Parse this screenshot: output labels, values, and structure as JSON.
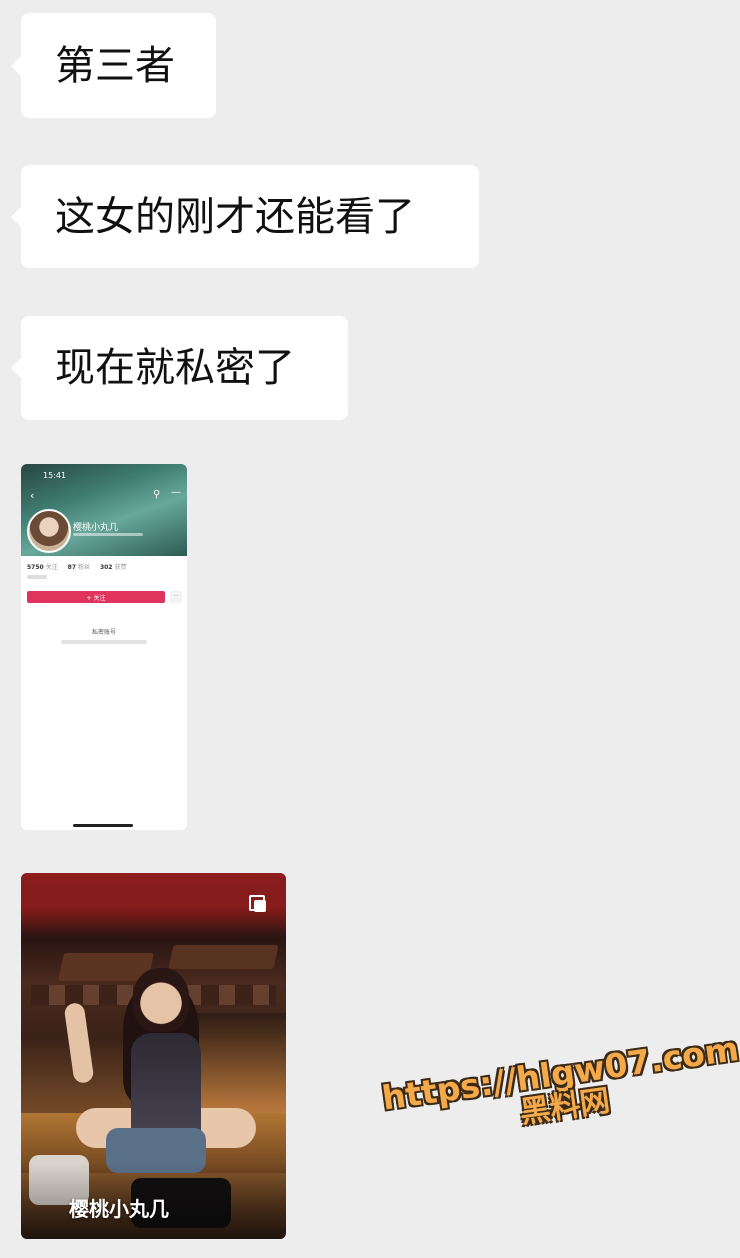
{
  "messages": [
    {
      "text": "第三者"
    },
    {
      "text": "这女的刚才还能看了"
    },
    {
      "text": "现在就私密了"
    }
  ],
  "profile_screenshot": {
    "status_time": "15:41",
    "name": "樱桃小丸几",
    "stats": [
      {
        "value": "5750",
        "label": "关注"
      },
      {
        "value": "87",
        "label": "粉丝"
      },
      {
        "value": "302",
        "label": "获赞"
      }
    ],
    "follow_label": "+ 关注",
    "private_text": "私密账号"
  },
  "photo_card": {
    "caption": "樱桃小丸几",
    "icon": "multi-image-icon"
  },
  "watermark": {
    "url": "https://hlgw07.com",
    "site_name": "黑料网",
    "color": "#f4a94a"
  }
}
